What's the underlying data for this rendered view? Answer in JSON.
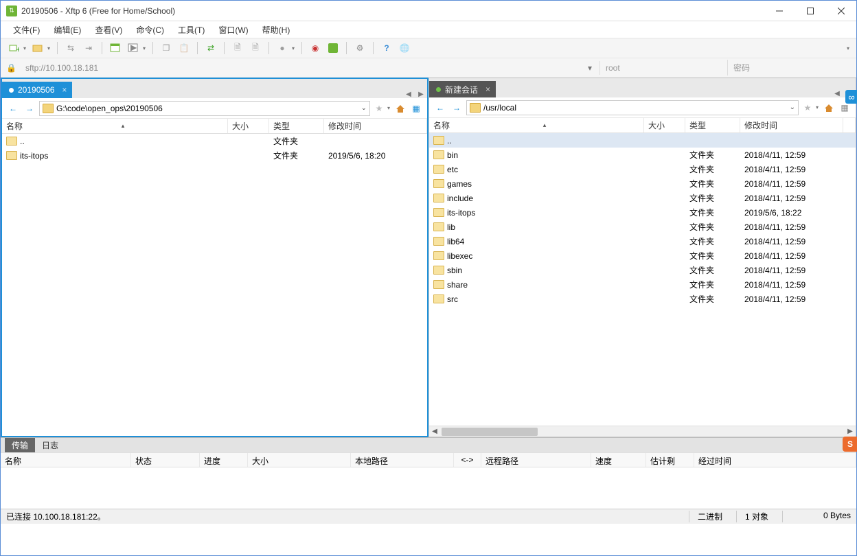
{
  "window": {
    "title": "20190506 - Xftp 6 (Free for Home/School)"
  },
  "menu": {
    "file": "文件(F)",
    "edit": "编辑(E)",
    "view": "查看(V)",
    "command": "命令(C)",
    "tools": "工具(T)",
    "window": "窗口(W)",
    "help": "帮助(H)"
  },
  "address": {
    "url": "sftp://10.100.18.181",
    "user": "root",
    "password_placeholder": "密码"
  },
  "left_pane": {
    "tab_label": "20190506",
    "path": "G:\\code\\open_ops\\20190506",
    "columns": {
      "name": "名称",
      "size": "大小",
      "type": "类型",
      "time": "修改时间"
    },
    "rows": [
      {
        "name": "..",
        "size": "",
        "type": "文件夹",
        "time": ""
      },
      {
        "name": "its-itops",
        "size": "",
        "type": "文件夹",
        "time": "2019/5/6, 18:20"
      }
    ]
  },
  "right_pane": {
    "tab_label": "新建会话",
    "path": "/usr/local",
    "columns": {
      "name": "名称",
      "size": "大小",
      "type": "类型",
      "time": "修改时间"
    },
    "rows": [
      {
        "name": "..",
        "size": "",
        "type": "",
        "time": ""
      },
      {
        "name": "bin",
        "size": "",
        "type": "文件夹",
        "time": "2018/4/11, 12:59"
      },
      {
        "name": "etc",
        "size": "",
        "type": "文件夹",
        "time": "2018/4/11, 12:59"
      },
      {
        "name": "games",
        "size": "",
        "type": "文件夹",
        "time": "2018/4/11, 12:59"
      },
      {
        "name": "include",
        "size": "",
        "type": "文件夹",
        "time": "2018/4/11, 12:59"
      },
      {
        "name": "its-itops",
        "size": "",
        "type": "文件夹",
        "time": "2019/5/6, 18:22"
      },
      {
        "name": "lib",
        "size": "",
        "type": "文件夹",
        "time": "2018/4/11, 12:59"
      },
      {
        "name": "lib64",
        "size": "",
        "type": "文件夹",
        "time": "2018/4/11, 12:59"
      },
      {
        "name": "libexec",
        "size": "",
        "type": "文件夹",
        "time": "2018/4/11, 12:59"
      },
      {
        "name": "sbin",
        "size": "",
        "type": "文件夹",
        "time": "2018/4/11, 12:59"
      },
      {
        "name": "share",
        "size": "",
        "type": "文件夹",
        "time": "2018/4/11, 12:59"
      },
      {
        "name": "src",
        "size": "",
        "type": "文件夹",
        "time": "2018/4/11, 12:59"
      }
    ]
  },
  "bottom": {
    "tab_transfer": "传输",
    "tab_log": "日志",
    "cols": {
      "name": "名称",
      "status": "状态",
      "progress": "进度",
      "size": "大小",
      "local": "本地路径",
      "arrow": "<->",
      "remote": "远程路径",
      "speed": "速度",
      "eta": "估计剩余...",
      "elapsed": "经过时间"
    }
  },
  "status": {
    "connected": "已连接 10.100.18.181:22。",
    "mode": "二进制",
    "count": "1 对象",
    "bytes": "0 Bytes"
  }
}
